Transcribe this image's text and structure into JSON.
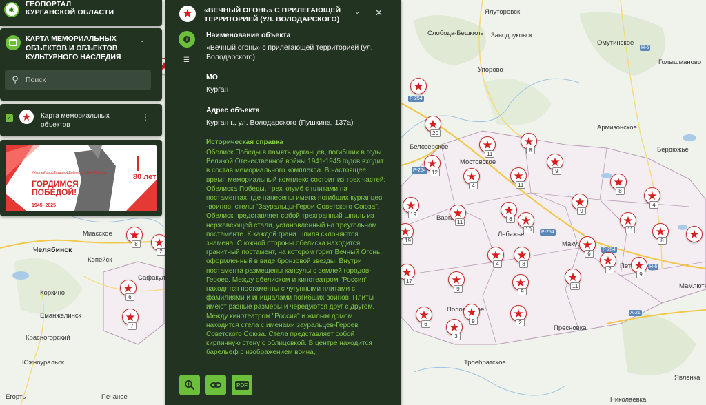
{
  "header": {
    "title_line1": "ГЕОПОРТАЛ",
    "title_line2": "КУРГАНСКОЙ ОБЛАСТИ",
    "logo_icon": "emblem-icon"
  },
  "layer": {
    "title": "КАРТА МЕМОРИАЛЬНЫХ ОБЪЕКТОВ И ОБЪЕКТОВ КУЛЬТУРНОГО НАСЛЕДИЯ",
    "search_placeholder": "Поиск"
  },
  "layer_item": {
    "label": "Карта мемориальных объектов",
    "checked": true
  },
  "banner": {
    "hashtags": "#КурганГородТрудовойДоблести #ВекуПобеды",
    "headline": "ГОРДИМСЯ ПОБЕДОЙ!",
    "years": "1945–2025",
    "anniversary": "80 лет"
  },
  "detail": {
    "title": "«ВЕЧНЫЙ ОГОНЬ» С ПРИЛЕГАЮЩЕЙ ТЕРРИТОРИЕЙ (УЛ. ВОЛОДАРСКОГО)",
    "fields": [
      {
        "label": "Наименование объекта",
        "value": "«Вечный огонь» с прилегающей территорией (ул. Володарского)"
      },
      {
        "label": "МО",
        "value": "Курган"
      },
      {
        "label": "Адрес объекта",
        "value": "Курган г., ул. Володарского (Пушкина, 137а)"
      }
    ],
    "history_label": "Историческая справка",
    "history_text": "Обелиск Победы в память курганцев, погибших в годы Великой Отечественной войны 1941-1945 годов входит в состав мемориального комплекса. В настоящее время мемориальный комплекс состоит из трех частей: Обелиска Победы, трех клумб с плитами на постаментах, где нанесены имена погибших курганцев -воинов, стелы \"Зауральцы-Герои Советского Союза\". Обелиск представляет собой трехгранный шпиль из нержавеющей стали, установленный на треугольном постаменте. К каждой грани шпиля склоняются знамена. С южной стороны обелиска находится гранитный постамент, на котором горит Вечный Огонь, оформленный в виде бронзовой звезды. Внутри постамента размещены капсулы с землей городов-Героев. Между обелиском и кинотеатром \"Россия\" находятся постаменты с чугунными плитами с фамилиями и инициалами погибших воинов. Плиты имеют разные размеры и чередуются друг с другом. Между кинотеатром \"Россия\" и жилым домом находится стела с именами зауральцев-Героев Советского Союза. Стела представляет собой кирпичную стену с облицовкой. В центре находится барельеф с изображением воина,",
    "actions": [
      "zoom-icon",
      "link-icon",
      "pdf-icon"
    ],
    "pdf_label": "PDF"
  },
  "map": {
    "places": [
      {
        "name": "Ялуторовск",
        "big": false
      },
      {
        "name": "Слобода-Бешкиль",
        "big": false
      },
      {
        "name": "Заводоуковск",
        "big": false
      },
      {
        "name": "Омутинское",
        "big": false
      },
      {
        "name": "Голышманово",
        "big": false
      },
      {
        "name": "Упорово",
        "big": false
      },
      {
        "name": "Армизонское",
        "big": false
      },
      {
        "name": "Белозерское",
        "big": false
      },
      {
        "name": "Бердюжье",
        "big": false
      },
      {
        "name": "Мостовское",
        "big": false
      },
      {
        "name": "Лебяжье",
        "big": false
      },
      {
        "name": "Варга",
        "big": false
      },
      {
        "name": "Макушино",
        "big": false
      },
      {
        "name": "Петухово",
        "big": false
      },
      {
        "name": "Мамлютка",
        "big": false
      },
      {
        "name": "Половинное",
        "big": false
      },
      {
        "name": "Пресновка",
        "big": false
      },
      {
        "name": "Троебратское",
        "big": false
      },
      {
        "name": "Явленка",
        "big": false
      },
      {
        "name": "Николаевка",
        "big": false
      },
      {
        "name": "Миасское",
        "big": false
      },
      {
        "name": "Челябинск",
        "big": true
      },
      {
        "name": "Копейск",
        "big": false
      },
      {
        "name": "Сафакулево",
        "big": false
      },
      {
        "name": "Коркино",
        "big": false
      },
      {
        "name": "Еманжелинск",
        "big": false
      },
      {
        "name": "Красногорский",
        "big": false
      },
      {
        "name": "Южноуральск",
        "big": false
      },
      {
        "name": "Печаное",
        "big": false
      },
      {
        "name": "Егорть",
        "big": false
      }
    ],
    "roads": [
      "Р-254",
      "Р-254",
      "Р-254",
      "Р-254",
      "А-21",
      "Н-6",
      "Н-6"
    ],
    "road_tag": "Р-254",
    "markers": [
      {
        "count": null
      },
      {
        "count": "20"
      },
      {
        "count": "11"
      },
      {
        "count": "8"
      },
      {
        "count": "12"
      },
      {
        "count": "9"
      },
      {
        "count": "4"
      },
      {
        "count": "11"
      },
      {
        "count": "8"
      },
      {
        "count": "4"
      },
      {
        "count": "19"
      },
      {
        "count": "11"
      },
      {
        "count": "6"
      },
      {
        "count": "9"
      },
      {
        "count": "10"
      },
      {
        "count": "11"
      },
      {
        "count": "8"
      },
      {
        "count": "19"
      },
      {
        "count": "6"
      },
      {
        "count": null
      },
      {
        "count": "4"
      },
      {
        "count": "8"
      },
      {
        "count": "2"
      },
      {
        "count": "9"
      },
      {
        "count": "17"
      },
      {
        "count": "9"
      },
      {
        "count": "11"
      },
      {
        "count": "9"
      },
      {
        "count": "9"
      },
      {
        "count": "6"
      },
      {
        "count": "3"
      },
      {
        "count": "2"
      },
      {
        "count": "8"
      },
      {
        "count": "2"
      },
      {
        "count": "6"
      },
      {
        "count": "7"
      },
      {
        "count": null
      }
    ],
    "marker_icon": "red-star-icon",
    "accent_color": "#6bbf3a",
    "panel_color": "#223322",
    "marker_color": "#d32020"
  }
}
